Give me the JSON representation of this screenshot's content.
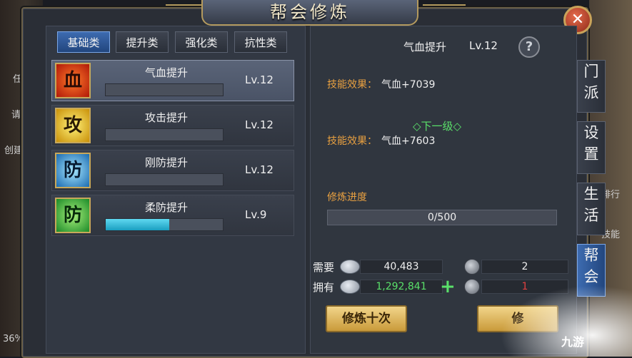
{
  "window": {
    "title": "帮会修炼"
  },
  "tabs": [
    "基础类",
    "提升类",
    "强化类",
    "抗性类"
  ],
  "skills": [
    {
      "icon_char": "血",
      "name": "气血提升",
      "level": "Lv.12",
      "progress": 0.0
    },
    {
      "icon_char": "攻",
      "name": "攻击提升",
      "level": "Lv.12",
      "progress": 0.0
    },
    {
      "icon_char": "防",
      "name": "刚防提升",
      "level": "Lv.12",
      "progress": 0.0
    },
    {
      "icon_char": "防",
      "name": "柔防提升",
      "level": "Lv.9",
      "progress": 0.54
    }
  ],
  "detail": {
    "skill_name": "气血提升",
    "level": "Lv.12",
    "help": "?",
    "effect_label": "技能效果：",
    "current_effect": "气血+7039",
    "next_level_label": "◇下一级◇",
    "next_effect": "气血+7603",
    "progress_label": "修炼进度",
    "progress_text": "0/500",
    "need_label": "需要",
    "have_label": "拥有",
    "need_coins": "40,483",
    "need_items": "2",
    "have_coins": "1,292,841",
    "have_items": "1"
  },
  "buttons": {
    "train_ten": "修炼十次",
    "train_one": "修"
  },
  "side_tabs": [
    "门派",
    "设置",
    "生活",
    "帮会"
  ],
  "background_left": {
    "text1": "任",
    "text2": "请",
    "text3": "创建帮",
    "text4": "36%"
  },
  "background_right": {
    "text1": "排行",
    "text2": "技能"
  },
  "watermark": "九游",
  "colors": {
    "accent_blue": "#3d6bb0",
    "effect_orange": "#e8a040",
    "next_green": "#5ae06a",
    "progress_cyan": "#1a9fc0",
    "owned_red": "#e04040",
    "gold_button": "#f2d58a"
  }
}
